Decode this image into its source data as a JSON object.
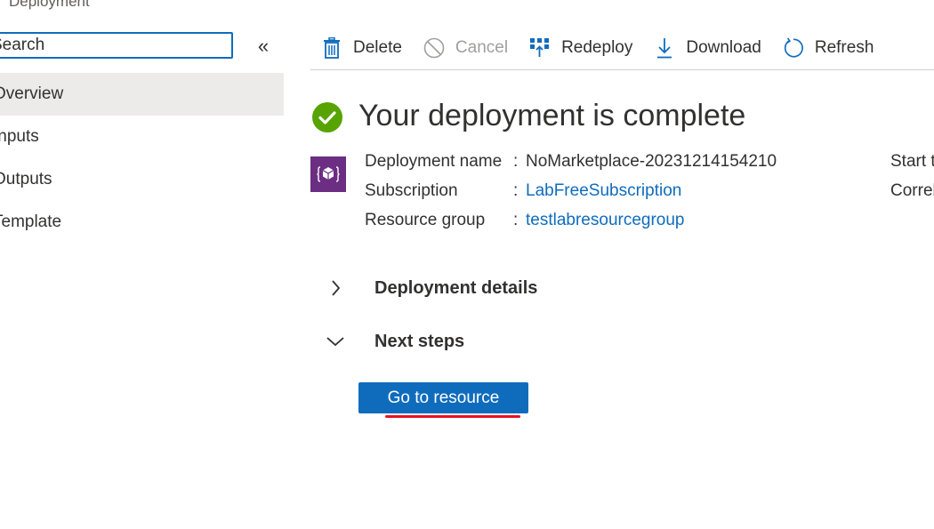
{
  "header": {
    "breadcrumb": "Deployment"
  },
  "sidebar": {
    "search_placeholder": "Search",
    "collapse_symbol": "«",
    "items": [
      {
        "label": "Overview",
        "active": true
      },
      {
        "label": "Inputs",
        "active": false
      },
      {
        "label": "Outputs",
        "active": false
      },
      {
        "label": "Template",
        "active": false
      }
    ]
  },
  "toolbar": {
    "delete_label": "Delete",
    "cancel_label": "Cancel",
    "redeploy_label": "Redeploy",
    "download_label": "Download",
    "refresh_label": "Refresh"
  },
  "main": {
    "title": "Your deployment is complete",
    "properties": [
      {
        "label": "Deployment name",
        "value": "NoMarketplace-20231214154210",
        "link": false
      },
      {
        "label": "Subscription",
        "value": "LabFreeSubscription",
        "link": true
      },
      {
        "label": "Resource group",
        "value": "testlabresourcegroup",
        "link": true
      }
    ],
    "properties_right": [
      "Start time",
      "Correlation ID"
    ],
    "sections": {
      "deployment_details": "Deployment details",
      "next_steps": "Next steps"
    },
    "go_to_resource_label": "Go to resource"
  },
  "colors": {
    "accent": "#0f6cbd",
    "success": "#57a300",
    "resource_icon_bg": "#6b2e82",
    "highlight_underline": "#e81123"
  },
  "icons": [
    "collapse-icon",
    "delete-icon",
    "cancel-icon",
    "redeploy-icon",
    "download-icon",
    "refresh-icon",
    "success-check-icon",
    "resource-template-icon",
    "chevron-right-icon",
    "chevron-down-icon"
  ]
}
